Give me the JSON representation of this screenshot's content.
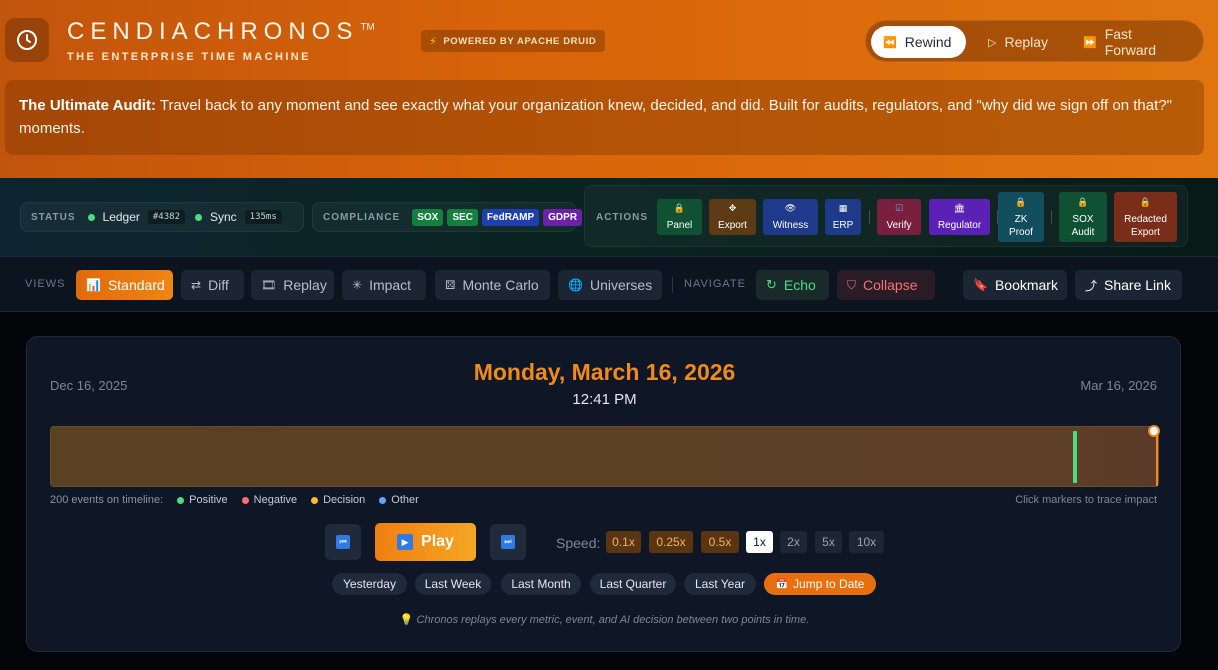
{
  "header": {
    "brand": "CENDIACHRONOS",
    "trademark": "TM",
    "tagline": "THE ENTERPRISE TIME MACHINE",
    "powered_by": "POWERED BY APACHE DRUID",
    "modes": [
      {
        "label": "Rewind",
        "active": true
      },
      {
        "label": "Replay",
        "active": false
      },
      {
        "label": "Fast Forward",
        "active": false
      }
    ],
    "intro_bold": "The Ultimate Audit:",
    "intro_text": " Travel back to any moment and see exactly what your organization knew, decided, and did. Built for audits, regulators, and \"why did we sign off on that?\" moments."
  },
  "status": {
    "label": "STATUS",
    "ledger_label": "Ledger",
    "ledger_id": "#4382",
    "sync_label": "Sync",
    "sync_latency": "135ms"
  },
  "compliance": {
    "label": "COMPLIANCE",
    "tags": [
      {
        "label": "SOX",
        "color": "#15803d"
      },
      {
        "label": "SEC",
        "color": "#15803d"
      },
      {
        "label": "FedRAMP",
        "color": "#1e40af"
      },
      {
        "label": "GDPR",
        "color": "#6b21a8"
      }
    ]
  },
  "actions": {
    "label": "ACTIONS",
    "items": [
      {
        "label": "Panel",
        "icon": "lock-icon",
        "color": "#0f5132"
      },
      {
        "label": "Export",
        "icon": "crosshair-icon",
        "color": "#5c3a14"
      },
      {
        "label": "Witness",
        "icon": "eye-icon",
        "color": "#1e3a8a"
      },
      {
        "label": "ERP",
        "icon": "grid-icon",
        "color": "#1e3a8a"
      },
      {
        "label": "Verify",
        "icon": "check-icon",
        "color": "#7a1f3d"
      },
      {
        "label": "Regulator",
        "icon": "building-icon",
        "color": "#5b21b6"
      },
      {
        "label": "ZK\nProof",
        "icon": "lock-icon",
        "color": "#134e5e"
      },
      {
        "label": "SOX\nAudit",
        "icon": "lock-icon",
        "color": "#0f5132"
      },
      {
        "label": "Redacted\nExport",
        "icon": "lock-icon",
        "color": "#7a2e1a"
      }
    ]
  },
  "views": {
    "label": "VIEWS",
    "items": [
      {
        "label": "Standard",
        "icon": "bar-chart-icon",
        "active": true
      },
      {
        "label": "Diff",
        "icon": "diff-icon",
        "active": false
      },
      {
        "label": "Replay",
        "icon": "film-icon",
        "active": false
      },
      {
        "label": "Impact",
        "icon": "network-icon",
        "active": false
      },
      {
        "label": "Monte Carlo",
        "icon": "dice-icon",
        "active": false
      },
      {
        "label": "Universes",
        "icon": "globe-icon",
        "active": false
      }
    ],
    "navigate_label": "NAVIGATE",
    "echo": "Echo",
    "collapse": "Collapse",
    "bookmark": "Bookmark",
    "share": "Share Link"
  },
  "timeline": {
    "start_date": "Dec 16, 2025",
    "end_date": "Mar 16, 2026",
    "current_date": "Monday, March 16, 2026",
    "current_time": "12:41 PM",
    "events_label": "200 events on timeline:",
    "legend": [
      {
        "label": "Positive",
        "color": "#4ade80"
      },
      {
        "label": "Negative",
        "color": "#f87171"
      },
      {
        "label": "Decision",
        "color": "#fbbf24"
      },
      {
        "label": "Other",
        "color": "#60a5fa"
      }
    ],
    "hint": "Click markers to trace impact",
    "play_label": "Play",
    "speed_label": "Speed:",
    "speeds": [
      {
        "label": "0.1x",
        "state": "dim"
      },
      {
        "label": "0.25x",
        "state": "dim"
      },
      {
        "label": "0.5x",
        "state": "dim"
      },
      {
        "label": "1x",
        "state": "sel"
      },
      {
        "label": "2x",
        "state": "off"
      },
      {
        "label": "5x",
        "state": "off"
      },
      {
        "label": "10x",
        "state": "off"
      }
    ],
    "quick_jumps": [
      "Yesterday",
      "Last Week",
      "Last Month",
      "Last Quarter",
      "Last Year"
    ],
    "jump_label": "Jump to Date",
    "footer": "Chronos replays every metric, event, and AI decision between two points in time."
  }
}
